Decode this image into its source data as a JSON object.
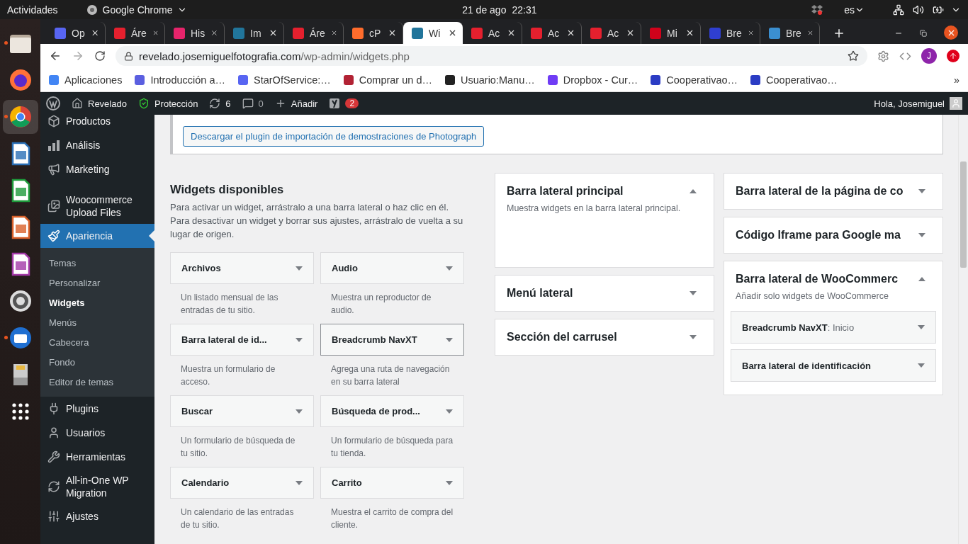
{
  "topbar": {
    "activities": "Actividades",
    "app": "Google Chrome",
    "date": "21 de ago",
    "time": "22:31",
    "language": "es"
  },
  "dock": [
    {
      "kind": "files",
      "running": true,
      "selected": false
    },
    {
      "kind": "firefox",
      "running": false,
      "selected": false
    },
    {
      "kind": "chrome",
      "running": true,
      "selected": true
    },
    {
      "kind": "writer",
      "running": false,
      "selected": false
    },
    {
      "kind": "calc",
      "running": false,
      "selected": false
    },
    {
      "kind": "impress",
      "running": false,
      "selected": false
    },
    {
      "kind": "base",
      "running": false,
      "selected": false
    },
    {
      "kind": "settings",
      "running": false,
      "selected": false
    },
    {
      "kind": "thunderbird",
      "running": true,
      "selected": false
    },
    {
      "kind": "sdcard",
      "running": false,
      "selected": false
    },
    {
      "kind": "apps",
      "running": false,
      "selected": false
    }
  ],
  "tabs": [
    {
      "title": "Op",
      "color": "#5865f2",
      "selected": false
    },
    {
      "title": "Áre",
      "color": "#e5202e",
      "selected": false
    },
    {
      "title": "His",
      "color": "#e6246b",
      "selected": false
    },
    {
      "title": "Im",
      "color": "#21759b",
      "selected": false
    },
    {
      "title": "Áre",
      "color": "#e5202e",
      "selected": false
    },
    {
      "title": "cP",
      "color": "#ff6c2c",
      "selected": false
    },
    {
      "title": "Wi",
      "color": "#21759b",
      "selected": true
    },
    {
      "title": "Ac",
      "color": "#e5202e",
      "selected": false
    },
    {
      "title": "Ac",
      "color": "#e5202e",
      "selected": false
    },
    {
      "title": "Ac",
      "color": "#e5202e",
      "selected": false
    },
    {
      "title": "Mi",
      "color": "#d0021b",
      "selected": false
    },
    {
      "title": "Bre",
      "color": "#2f3fd0",
      "selected": false
    },
    {
      "title": "Bre",
      "color": "#3b8fd0",
      "selected": false
    }
  ],
  "address": {
    "domain": "revelado.josemiguelfotografia.com",
    "path": "/wp-admin/widgets.php"
  },
  "profile": "J",
  "bookmarks": [
    {
      "label": "Aplicaciones",
      "color": "#4285f4"
    },
    {
      "label": "Introducción a…",
      "color": "#5b5fe0"
    },
    {
      "label": "StarOfService:…",
      "color": "#5865f2"
    },
    {
      "label": "Comprar un d…",
      "color": "#b22234"
    },
    {
      "label": "Usuario:Manu…",
      "color": "#222222"
    },
    {
      "label": "Dropbox - Cur…",
      "color": "#6f3cf5"
    },
    {
      "label": "Cooperativao…",
      "color": "#2b3cc4"
    },
    {
      "label": "Cooperativao…",
      "color": "#2b3cc4"
    }
  ],
  "bookmarks_more": "»",
  "adminbar": {
    "site": "Revelado",
    "security": "Protección",
    "updates": "6",
    "comments": "0",
    "add": "Añadir",
    "seo_count": "2",
    "greeting": "Hola, Josemiguel"
  },
  "menu": [
    {
      "label": "Productos",
      "selected": false
    },
    {
      "label": "Análisis",
      "selected": false
    },
    {
      "label": "Marketing",
      "selected": false
    },
    {
      "label": "Woocommerce Upload Files",
      "selected": false
    },
    {
      "label": "Apariencia",
      "selected": true,
      "children": [
        {
          "label": "Temas",
          "selected": false
        },
        {
          "label": "Personalizar",
          "selected": false
        },
        {
          "label": "Widgets",
          "selected": true
        },
        {
          "label": "Menús",
          "selected": false
        },
        {
          "label": "Cabecera",
          "selected": false
        },
        {
          "label": "Fondo",
          "selected": false
        },
        {
          "label": "Editor de temas",
          "selected": false
        }
      ]
    },
    {
      "label": "Plugins",
      "selected": false
    },
    {
      "label": "Usuarios",
      "selected": false
    },
    {
      "label": "Herramientas",
      "selected": false
    },
    {
      "label": "All-in-One WP Migration",
      "selected": false
    },
    {
      "label": "Ajustes",
      "selected": false
    }
  ],
  "notice": {
    "button": "Descargar el plugin de importación de demostraciones de Photograph"
  },
  "available": {
    "title": "Widgets disponibles",
    "description": "Para activar un widget, arrástralo a una barra lateral o haz clic en él. Para desactivar un widget y borrar sus ajustes, arrástralo de vuelta a su lugar de origen.",
    "widgets": [
      {
        "title": "Archivos",
        "description": "Un listado mensual de las entradas de tu sitio.",
        "selected": false
      },
      {
        "title": "Audio",
        "description": "Muestra un reproductor de audio.",
        "selected": false
      },
      {
        "title": "Barra lateral de id...",
        "description": "Muestra un formulario de acceso.",
        "selected": false
      },
      {
        "title": "Breadcrumb NavXT",
        "description": "Agrega una ruta de navegación en su barra lateral",
        "selected": true
      },
      {
        "title": "Buscar",
        "description": "Un formulario de búsqueda de tu sitio.",
        "selected": false
      },
      {
        "title": "Búsqueda de prod...",
        "description": "Un formulario de búsqueda para tu tienda.",
        "selected": false
      },
      {
        "title": "Calendario",
        "description": "Un calendario de las entradas de tu sitio.",
        "selected": false
      },
      {
        "title": "Carrito",
        "description": "Muestra el carrito de compra del cliente.",
        "selected": false
      }
    ]
  },
  "sidebars": [
    [
      {
        "title": "Barra lateral principal",
        "expanded": true,
        "description": "Muestra widgets en la barra lateral principal."
      },
      {
        "title": "Menú lateral",
        "expanded": false
      },
      {
        "title": "Sección del carrusel",
        "expanded": false
      }
    ],
    [
      {
        "title": "Barra lateral de la página de co",
        "expanded": false
      },
      {
        "title": "Código Iframe para Google ma",
        "expanded": false
      },
      {
        "title": "Barra lateral de WooCommerc",
        "expanded": true,
        "description": "Añadir solo widgets de WooCommerce",
        "widgets": [
          {
            "title": "Breadcrumb NavXT",
            "subtitle": ": Inicio"
          },
          {
            "title": "Barra lateral de identificación"
          }
        ]
      }
    ]
  ]
}
